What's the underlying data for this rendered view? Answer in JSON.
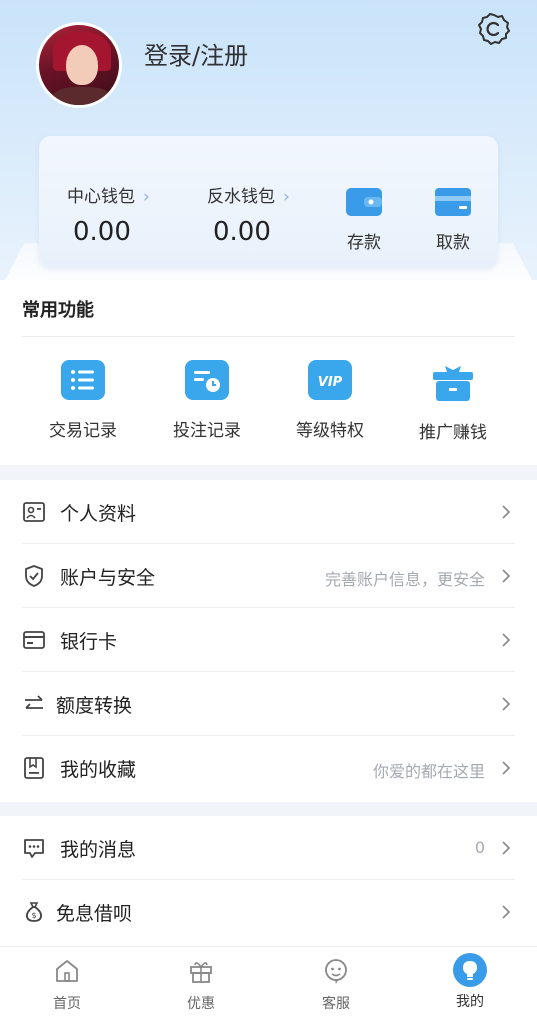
{
  "header": {
    "login_label": "登录/注册"
  },
  "wallet": {
    "center": {
      "label": "中心钱包",
      "value": "0.00"
    },
    "rebate": {
      "label": "反水钱包",
      "value": "0.00"
    },
    "deposit_label": "存款",
    "withdraw_label": "取款"
  },
  "functions": {
    "title": "常用功能",
    "items": [
      {
        "label": "交易记录",
        "icon": "list-icon"
      },
      {
        "label": "投注记录",
        "icon": "bet-record-icon"
      },
      {
        "label": "等级特权",
        "icon": "vip-icon"
      },
      {
        "label": "推广赚钱",
        "icon": "gift-icon"
      }
    ]
  },
  "menu1": [
    {
      "label": "个人资料",
      "hint": "",
      "icon": "profile-icon"
    },
    {
      "label": "账户与安全",
      "hint": "完善账户信息，更安全",
      "icon": "shield-icon"
    },
    {
      "label": "银行卡",
      "hint": "",
      "icon": "bank-card-icon"
    },
    {
      "label": "额度转换",
      "hint": "",
      "icon": "transfer-icon"
    },
    {
      "label": "我的收藏",
      "hint": "你爱的都在这里",
      "icon": "bookmark-icon"
    }
  ],
  "menu2": [
    {
      "label": "我的消息",
      "hint": "0",
      "icon": "message-icon"
    },
    {
      "label": "免息借呗",
      "hint": "",
      "icon": "money-bag-icon"
    }
  ],
  "tabs": [
    {
      "label": "首页",
      "icon": "home-icon"
    },
    {
      "label": "优惠",
      "icon": "gift-box-icon"
    },
    {
      "label": "客服",
      "icon": "support-icon"
    },
    {
      "label": "我的",
      "icon": "me-icon"
    }
  ],
  "colors": {
    "accent": "#3a9be8",
    "background": "#f1f4f9"
  }
}
